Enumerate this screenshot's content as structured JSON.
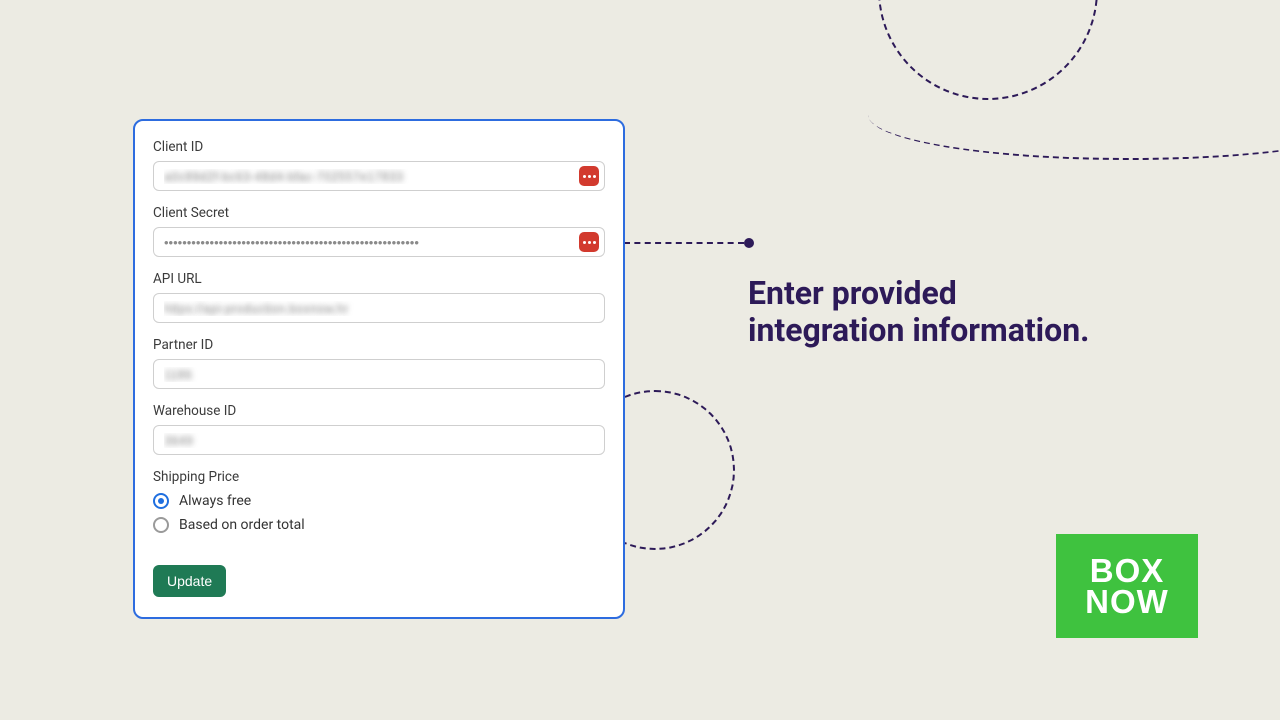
{
  "callout": {
    "line1": "Enter provided",
    "line2": "integration information."
  },
  "logo": {
    "line1": "BOX",
    "line2": "NOW"
  },
  "form": {
    "clientId": {
      "label": "Client ID",
      "value": "a0c89d2f-bc63-48d4-bfac-702557e17833"
    },
    "clientSecret": {
      "label": "Client Secret",
      "value": "••••••••••••••••••••••••••••••••••••••••••••••••••••••••"
    },
    "apiUrl": {
      "label": "API URL",
      "value": "https://api-production.boxnow.hr"
    },
    "partnerId": {
      "label": "Partner ID",
      "value": "1186"
    },
    "warehouseId": {
      "label": "Warehouse ID",
      "value": "3649"
    },
    "shippingPrice": {
      "label": "Shipping Price",
      "options": {
        "alwaysFree": "Always free",
        "basedOnTotal": "Based on order total"
      },
      "selected": "alwaysFree"
    },
    "updateLabel": "Update"
  }
}
